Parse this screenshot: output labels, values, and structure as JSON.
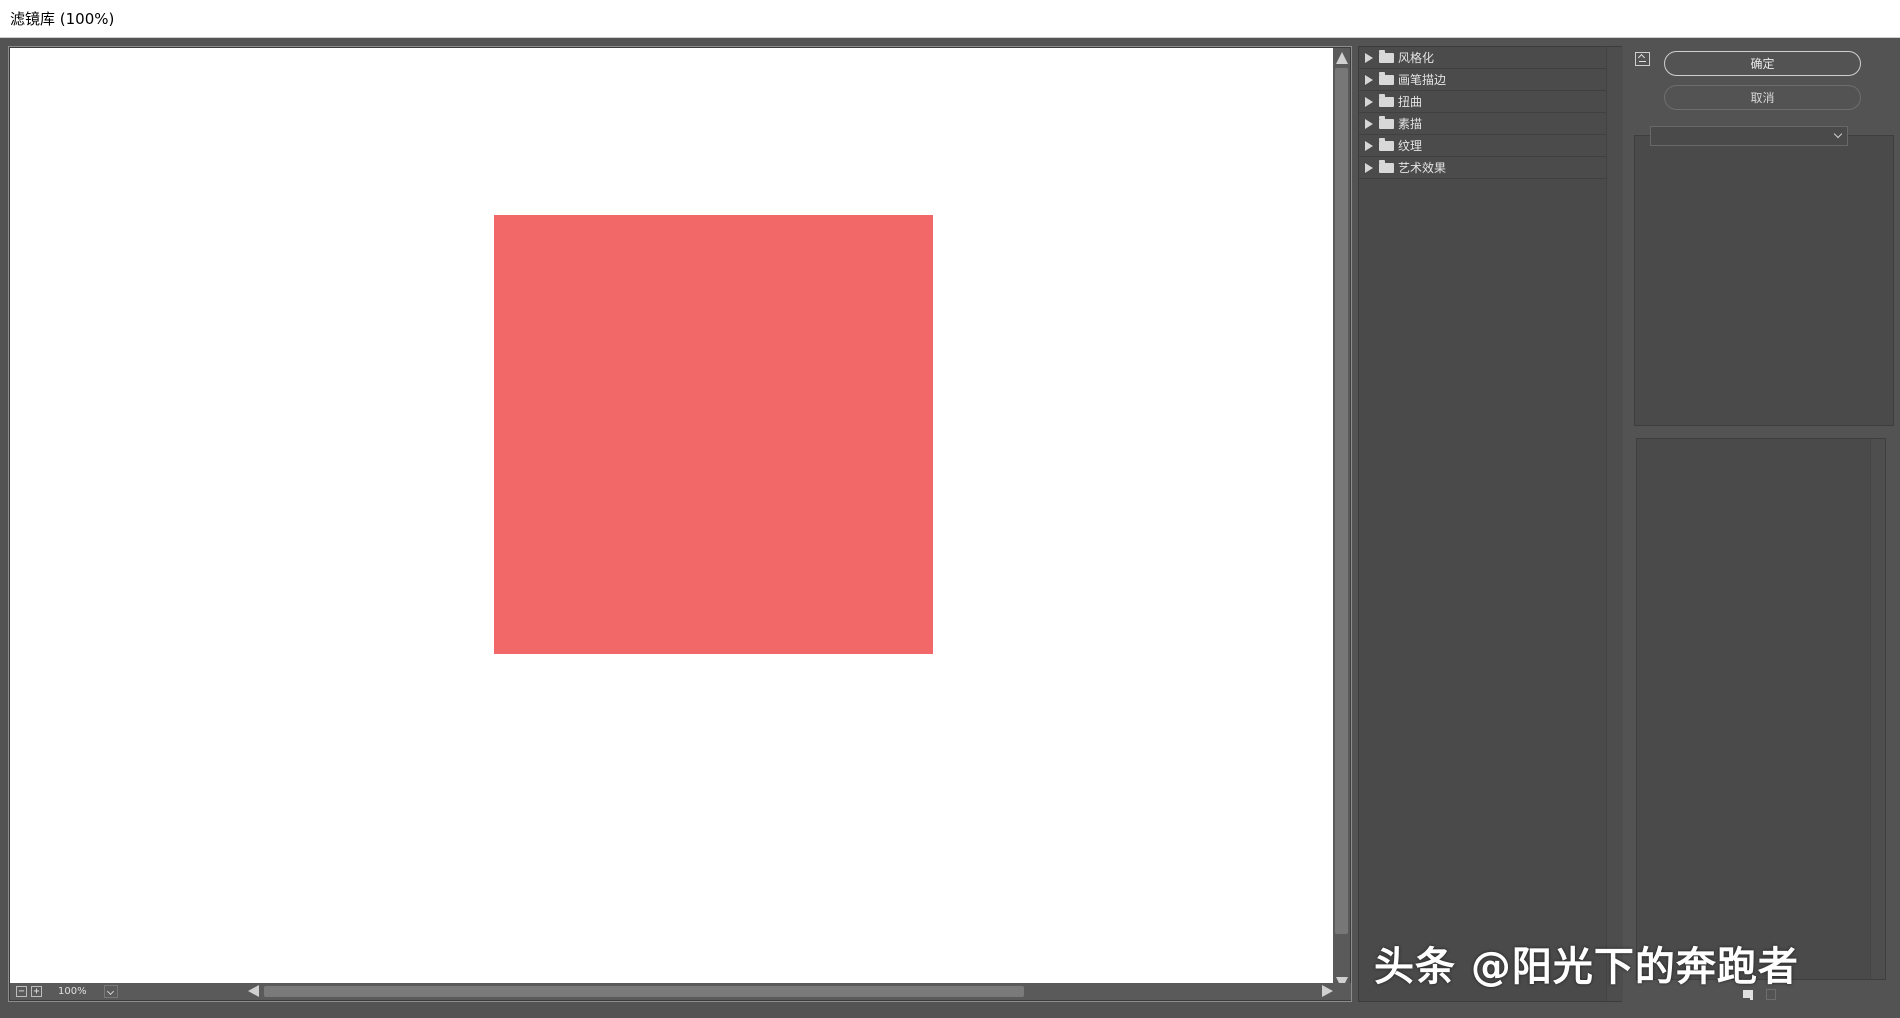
{
  "window": {
    "title": "滤镜库 (100%)"
  },
  "preview": {
    "zoom_value": "100%",
    "zoom_out": "−",
    "zoom_in": "+",
    "shape_color": "#f26868",
    "canvas_color": "#ffffff"
  },
  "filters": {
    "items": [
      {
        "label": "风格化",
        "icon": "folder-icon"
      },
      {
        "label": "画笔描边",
        "icon": "folder-icon"
      },
      {
        "label": "扭曲",
        "icon": "folder-icon"
      },
      {
        "label": "素描",
        "icon": "folder-icon"
      },
      {
        "label": "纹理",
        "icon": "folder-icon"
      },
      {
        "label": "艺术效果",
        "icon": "folder-icon"
      }
    ]
  },
  "buttons": {
    "ok": "确定",
    "cancel": "取消"
  },
  "filter_select": {
    "value": ""
  },
  "watermark": {
    "text": "头条 @阳光下的奔跑者"
  }
}
